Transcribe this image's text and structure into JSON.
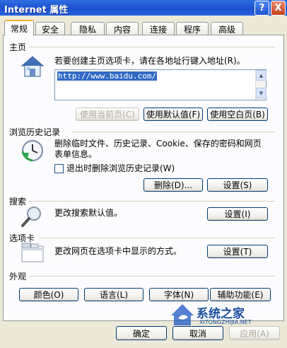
{
  "window": {
    "title": "Internet 属性",
    "help_label": "?",
    "close_label": "X"
  },
  "tabs": [
    {
      "label": "常规",
      "active": true
    },
    {
      "label": "安全"
    },
    {
      "label": "隐私"
    },
    {
      "label": "内容"
    },
    {
      "label": "连接"
    },
    {
      "label": "程序"
    },
    {
      "label": "高级"
    }
  ],
  "homepage": {
    "title": "主页",
    "description": "若要创建主页选项卡，请在各地址行键入地址(R)。",
    "url": "http://www.baidu.com/",
    "use_current_label": "使用当前页(C)",
    "use_default_label": "使用默认值(F)",
    "use_blank_label": "使用空白页(B)"
  },
  "history": {
    "title": "浏览历史记录",
    "description_line1": "删除临时文件、历史记录、Cookie、保存的密码和网页",
    "description_line2": "表单信息。",
    "checkbox_label": "退出时删除浏览历史记录(W)",
    "checkbox_checked": false,
    "delete_label": "删除(D)...",
    "settings_label": "设置(S)"
  },
  "search": {
    "title": "搜索",
    "description": "更改搜索默认值。",
    "settings_label": "设置(I)"
  },
  "tabs_section": {
    "title": "选项卡",
    "description": "更改网页在选项卡中显示的方式。",
    "settings_label": "设置(T)"
  },
  "appearance": {
    "title": "外观",
    "colors_label": "颜色(O)",
    "languages_label": "语言(L)",
    "fonts_label": "字体(N)",
    "accessibility_label": "辅助功能(E)"
  },
  "footer": {
    "ok_label": "确定",
    "cancel_label": "取消",
    "apply_label": "应用(A)"
  },
  "watermark": {
    "name": "系统之家",
    "url": "XITONGZHIJIA.NET"
  },
  "icons": {
    "homepage": "house-icon",
    "history": "clock-icon",
    "search": "magnifier-icon",
    "tabs": "window-tabs-icon"
  },
  "colors": {
    "titlebar": "#1c4fcf",
    "tab_highlight": "#f7b23b",
    "selection": "#316ac5"
  }
}
